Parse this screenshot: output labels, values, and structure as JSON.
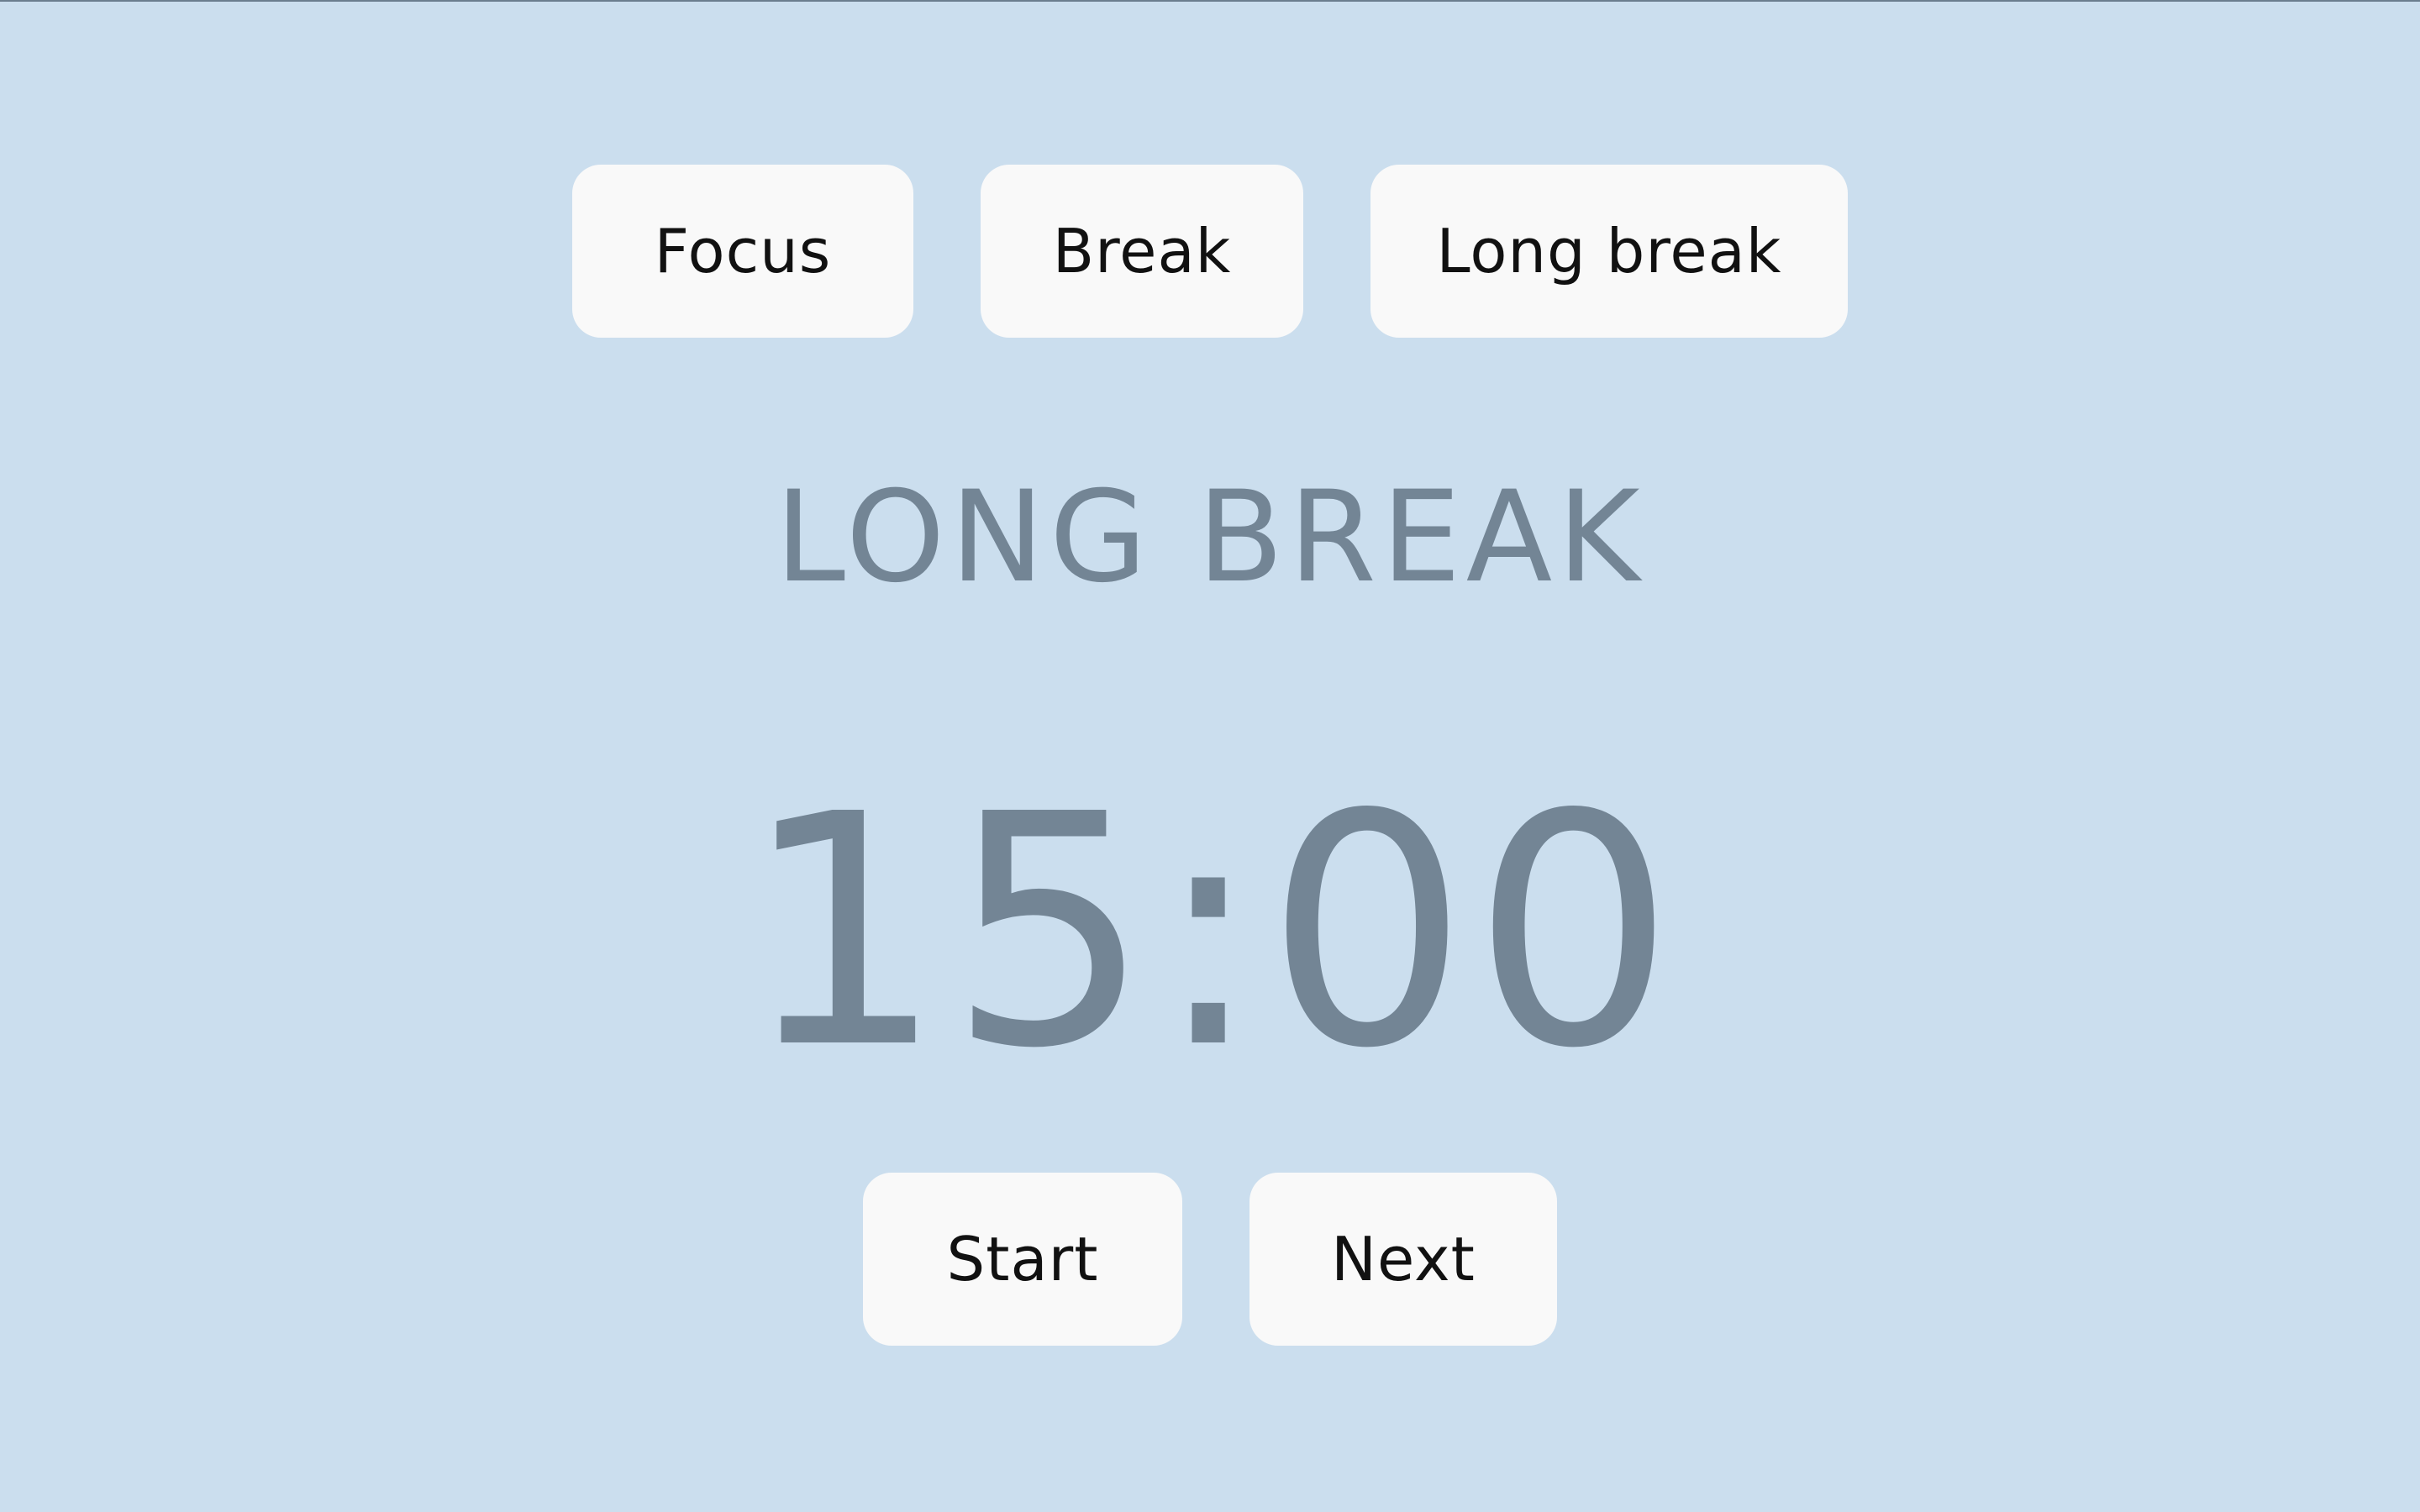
{
  "mode_tabs": {
    "focus_label": "Focus",
    "break_label": "Break",
    "long_break_label": "Long break"
  },
  "session": {
    "mode_title": "LONG BREAK",
    "timer_display": "15:00"
  },
  "controls": {
    "start_label": "Start",
    "next_label": "Next"
  },
  "colors": {
    "background": "#cbdeee",
    "button_background": "#f9f9f9",
    "text_muted": "#738595",
    "button_text": "#111111"
  }
}
